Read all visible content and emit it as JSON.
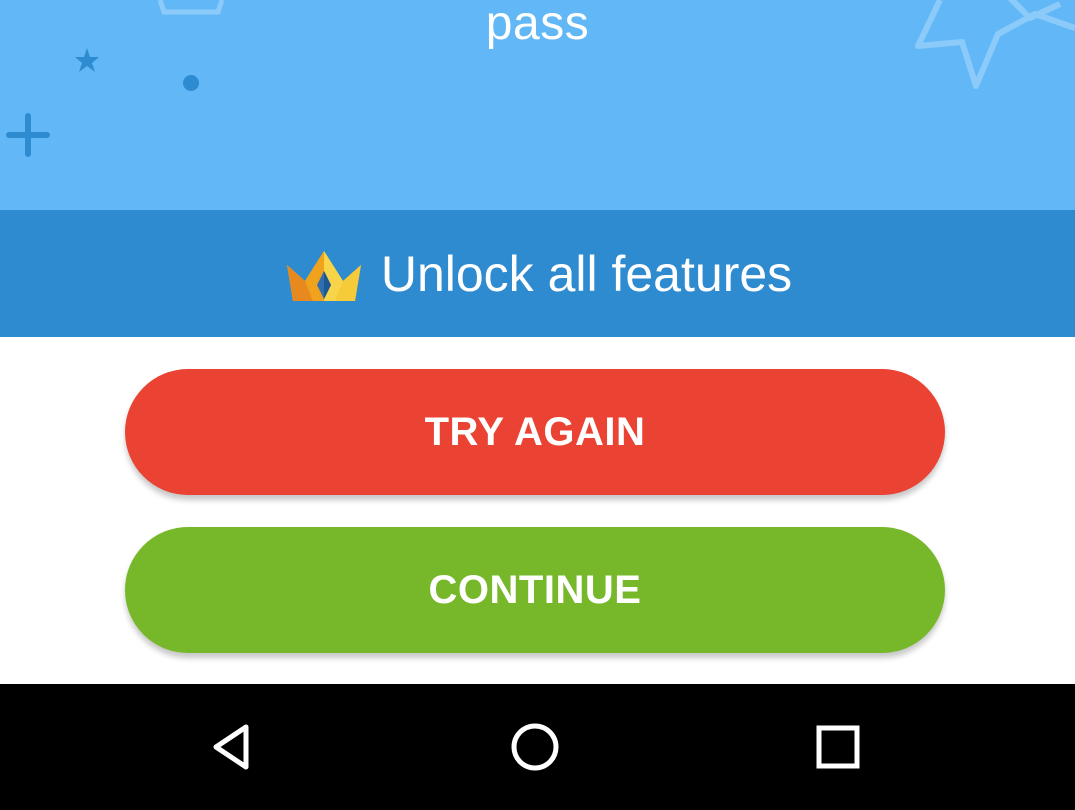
{
  "hero": {
    "title": "pass",
    "background_color": "#62b8f7"
  },
  "unlock": {
    "icon": "crown-icon",
    "label": "Unlock all features",
    "background_color": "#2f8bd0"
  },
  "buttons": {
    "try_again_label": "TRY AGAIN",
    "try_again_color": "#ea4233",
    "continue_label": "CONTINUE",
    "continue_color": "#76b82a"
  },
  "navbar": {
    "items": [
      {
        "icon": "back-triangle-icon"
      },
      {
        "icon": "home-circle-icon"
      },
      {
        "icon": "recent-apps-square-icon"
      }
    ]
  }
}
